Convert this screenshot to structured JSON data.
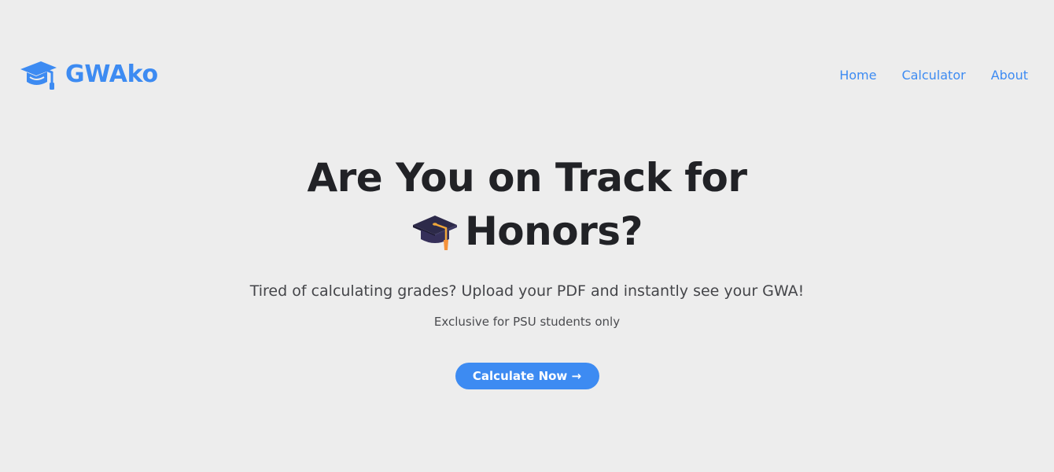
{
  "brand": {
    "name": "GWAko",
    "icon": "graduation-cap-icon",
    "color": "#3d8bf2"
  },
  "nav": {
    "items": [
      {
        "label": "Home"
      },
      {
        "label": "Calculator"
      },
      {
        "label": "About"
      }
    ]
  },
  "hero": {
    "title_line1": "Are You on Track for",
    "title_line2": "Honors?",
    "title_icon": "graduation-cap-emoji",
    "subtitle": "Tired of calculating grades? Upload your PDF and instantly see your GWA!",
    "note": "Exclusive for PSU students only",
    "cta_label": "Calculate Now →"
  },
  "colors": {
    "accent": "#3d8bf2",
    "background": "#ededed",
    "heading": "#212226"
  }
}
